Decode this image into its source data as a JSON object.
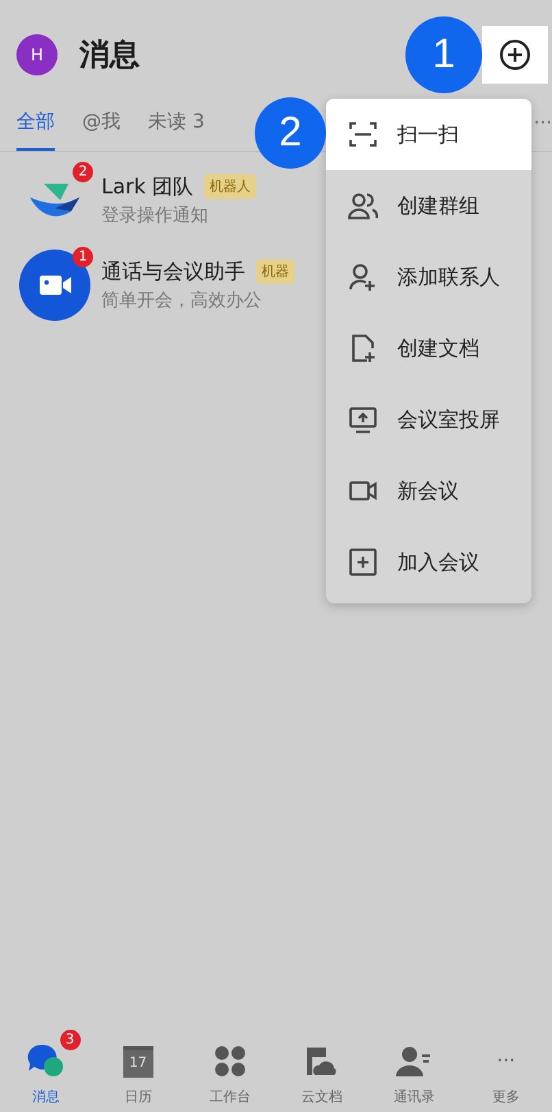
{
  "header": {
    "avatar": "H",
    "title": "消息"
  },
  "markers": [
    {
      "label": "1"
    },
    {
      "label": "2"
    }
  ],
  "tabs": [
    {
      "label": "全部",
      "selected": true
    },
    {
      "label": "@我",
      "selected": false
    },
    {
      "label": "未读 3",
      "selected": false
    }
  ],
  "more_tabs": "···",
  "chats": [
    {
      "kind": "lark",
      "name": "Lark 团队",
      "tag": "机器人",
      "badge": "2",
      "preview": "登录操作通知"
    },
    {
      "kind": "video",
      "name": "通话与会议助手",
      "tag": "机器",
      "badge": "1",
      "preview": "简单开会，高效办公"
    }
  ],
  "menu": [
    {
      "kind": "scan",
      "label": "扫一扫",
      "selected": true
    },
    {
      "kind": "group",
      "label": "创建群组",
      "selected": false
    },
    {
      "kind": "contact",
      "label": "添加联系人",
      "selected": false
    },
    {
      "kind": "doc",
      "label": "创建文档",
      "selected": false
    },
    {
      "kind": "screen",
      "label": "会议室投屏",
      "selected": false
    },
    {
      "kind": "meeting",
      "label": "新会议",
      "selected": false
    },
    {
      "kind": "join",
      "label": "加入会议",
      "selected": false
    }
  ],
  "nav": [
    {
      "kind": "chat",
      "label": "消息",
      "badge": "3",
      "selected": true
    },
    {
      "kind": "calendar",
      "label": "日历",
      "icon_text": "17",
      "selected": false
    },
    {
      "kind": "apps",
      "label": "工作台",
      "selected": false
    },
    {
      "kind": "docs",
      "label": "云文档",
      "selected": false
    },
    {
      "kind": "contacts",
      "label": "通讯录",
      "selected": false
    },
    {
      "kind": "more",
      "label": "更多",
      "icon_text": "···",
      "selected": false
    }
  ]
}
